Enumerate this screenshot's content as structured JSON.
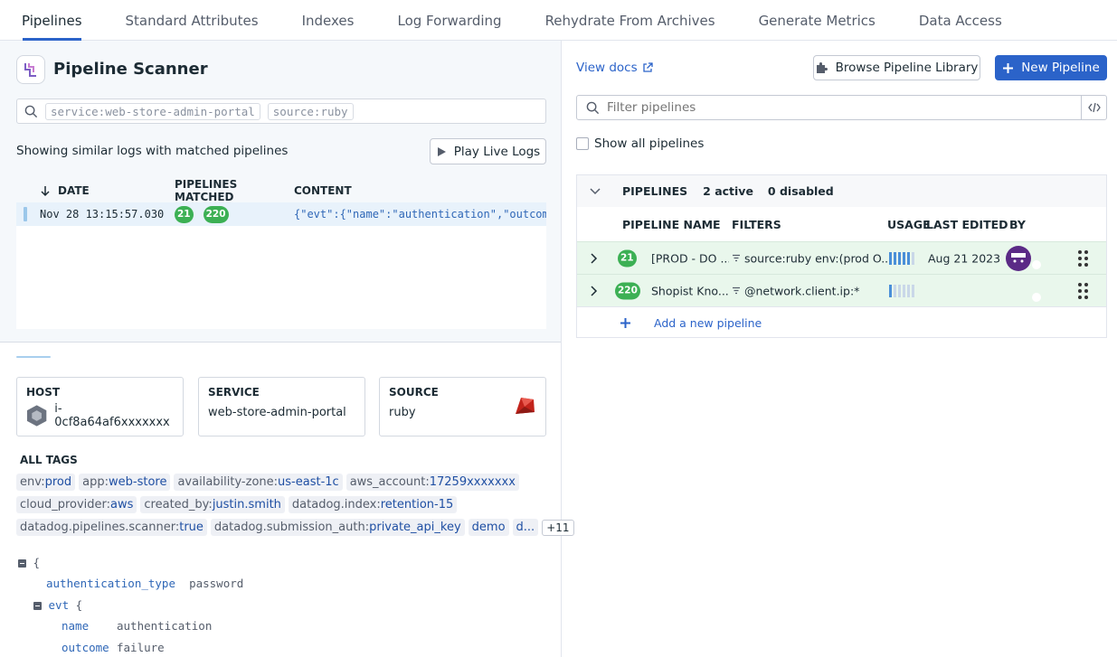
{
  "tabs": [
    {
      "label": "Pipelines",
      "active": true
    },
    {
      "label": "Standard Attributes",
      "active": false
    },
    {
      "label": "Indexes",
      "active": false
    },
    {
      "label": "Log Forwarding",
      "active": false
    },
    {
      "label": "Rehydrate From Archives",
      "active": false
    },
    {
      "label": "Generate Metrics",
      "active": false
    },
    {
      "label": "Data Access",
      "active": false
    }
  ],
  "scanner": {
    "title": "Pipeline Scanner",
    "query_chips": [
      "service:web-store-admin-portal",
      "source:ruby"
    ],
    "showing_text": "Showing similar logs with matched pipelines",
    "play_button": "Play Live Logs",
    "columns": {
      "date": "DATE",
      "pipelines": "PIPELINES MATCHED",
      "content": "CONTENT"
    },
    "row": {
      "date": "Nov 28 13:15:57.030",
      "badges": [
        "21",
        "220"
      ],
      "content": "{\"evt\":{\"name\":\"authentication\",\"outcome"
    }
  },
  "detail": {
    "host_label": "HOST",
    "host_value": "i-0cf8a64af6xxxxxxx",
    "service_label": "SERVICE",
    "service_value": "web-store-admin-portal",
    "source_label": "SOURCE",
    "source_value": "ruby",
    "all_tags_label": "ALL TAGS",
    "tag_rows": [
      [
        {
          "k": "env:",
          "v": "prod"
        },
        {
          "k": "app:",
          "v": "web-store"
        },
        {
          "k": "availability-zone:",
          "v": "us-east-1c"
        },
        {
          "k": "aws_account:",
          "v": "17259xxxxxxx"
        }
      ],
      [
        {
          "k": "cloud_provider:",
          "v": "aws"
        },
        {
          "k": "created_by:",
          "v": "justin.smith"
        },
        {
          "k": "datadog.index:",
          "v": "retention-15"
        }
      ],
      [
        {
          "k": "datadog.pipelines.scanner:",
          "v": "true"
        },
        {
          "k": "datadog.submission_auth:",
          "v": "private_api_key"
        },
        {
          "k": "",
          "v": "demo"
        },
        {
          "k": "",
          "v": "d..."
        }
      ]
    ],
    "more_tags": "+11",
    "json": {
      "open_brace": "{",
      "auth_key": "authentication_type",
      "auth_val": "password",
      "evt_key": "evt",
      "evt_brace": "{",
      "name_key": "name",
      "name_val": "authentication",
      "outcome_key": "outcome",
      "outcome_val": "failure"
    }
  },
  "right": {
    "view_docs": "View docs",
    "browse_button": "Browse Pipeline Library",
    "new_button": "New Pipeline",
    "filter_placeholder": "Filter pipelines",
    "show_all": "Show all pipelines",
    "header": {
      "pipelines": "PIPELINES",
      "active": "2 active",
      "disabled": "0 disabled"
    },
    "columns": {
      "name": "PIPELINE NAME",
      "filters": "FILTERS",
      "usage": "USAGE",
      "last_edited": "LAST EDITED",
      "by": "BY"
    },
    "pipelines": [
      {
        "badge": "21",
        "name": "[PROD - DO ...",
        "filter": "source:ruby env:(prod O...",
        "usage": 0.8,
        "last_edited": "Aug 21 2023",
        "enabled": true
      },
      {
        "badge": "220",
        "name": "Shopist Kno...",
        "filter": "@network.client.ip:*",
        "usage": 0.2,
        "last_edited": "",
        "enabled": true
      }
    ],
    "add_pipeline": "Add a new pipeline"
  }
}
